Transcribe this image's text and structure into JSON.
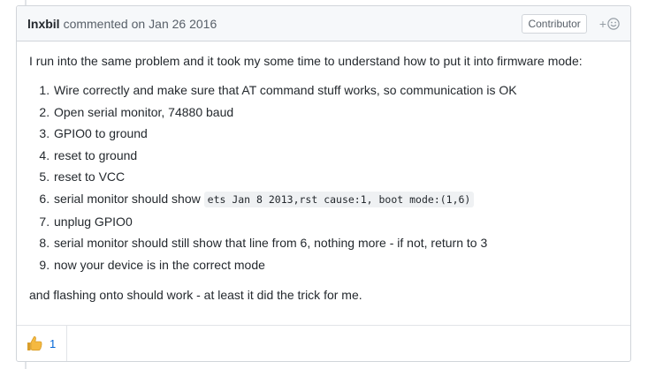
{
  "comment": {
    "author": "lnxbil",
    "action": "commented on",
    "date": "Jan 26 2016",
    "role_badge": "Contributor",
    "reaction_add_symbol": "+",
    "intro": "I run into the same problem and it took my some time to understand how to put it into firmware mode:",
    "steps": [
      "Wire correctly and make sure that AT command stuff works, so communication is OK",
      "Open serial monitor, 74880 baud",
      "GPIO0 to ground",
      "reset to ground",
      "reset to VCC",
      "serial monitor should show ",
      "unplug GPIO0",
      "serial monitor should still show that line from 6, nothing more - if not, return to 3",
      "now your device is in the correct mode"
    ],
    "step6_code": "ets Jan 8 2013,rst cause:1, boot mode:(1,6)",
    "closing": "and flashing onto should work - at least it did the trick for me.",
    "reaction": {
      "icon": "thumbs-up",
      "count": "1"
    }
  },
  "colors": {
    "header_bg": "#f6f8fa",
    "border": "#d1d5da",
    "link_blue": "#0366d6",
    "thumb_yellow": "#f5b940"
  }
}
